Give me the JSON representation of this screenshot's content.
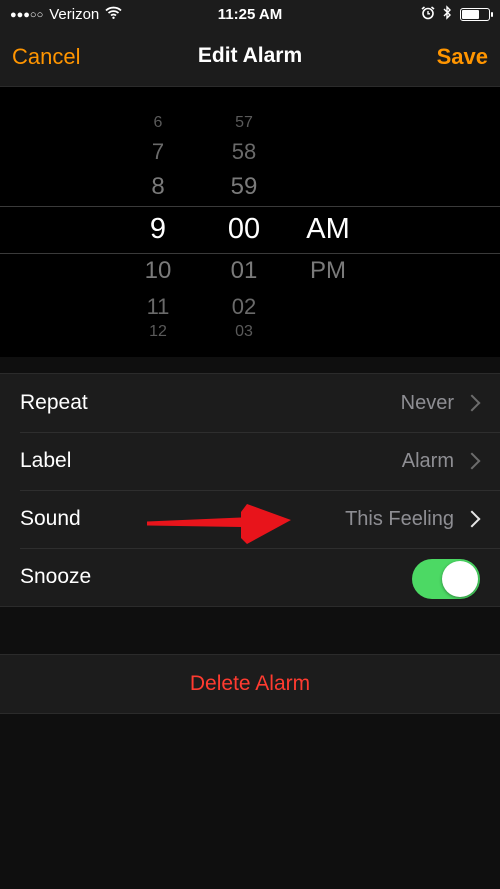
{
  "status_bar": {
    "signal": "●●●○○",
    "carrier": "Verizon",
    "time": "11:25 AM",
    "icons": [
      "wifi-icon",
      "alarm-icon",
      "bluetooth-icon",
      "battery-icon"
    ]
  },
  "nav": {
    "cancel_label": "Cancel",
    "title": "Edit Alarm",
    "save_label": "Save"
  },
  "picker": {
    "hours": [
      "6",
      "7",
      "8",
      "9",
      "10",
      "11",
      "12"
    ],
    "minutes": [
      "57",
      "58",
      "59",
      "00",
      "01",
      "02",
      "03"
    ],
    "periods": [
      "AM",
      "PM"
    ],
    "selected": {
      "hour": "9",
      "minute": "00",
      "period": "AM"
    }
  },
  "settings": {
    "repeat": {
      "label": "Repeat",
      "value": "Never"
    },
    "label": {
      "label": "Label",
      "value": "Alarm"
    },
    "sound": {
      "label": "Sound",
      "value": "This Feeling"
    },
    "snooze": {
      "label": "Snooze",
      "enabled": true
    }
  },
  "delete_label": "Delete Alarm",
  "colors": {
    "accent": "#ff9500",
    "destructive": "#ff3b30",
    "toggle_on": "#4cd964",
    "annotation_arrow": "#e8141b"
  }
}
